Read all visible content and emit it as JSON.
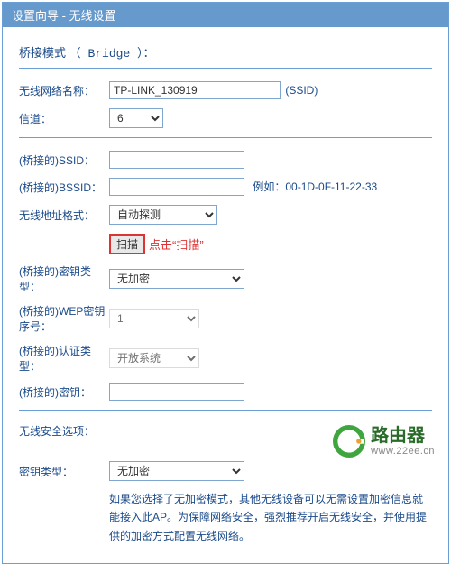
{
  "header": {
    "title": "设置向导 - 无线设置"
  },
  "mode": {
    "label": "桥接模式",
    "english": "（ Bridge ）："
  },
  "wlan": {
    "ssid_label": "无线网络名称：",
    "ssid_value": "TP-LINK_130919",
    "ssid_tag": "(SSID)",
    "channel_label": "信道：",
    "channel_value": "6"
  },
  "bridge": {
    "ssid_label": "(桥接的)SSID：",
    "ssid_value": "",
    "bssid_label": "(桥接的)BSSID：",
    "bssid_value": "",
    "bssid_example": "例如：00-1D-0F-11-22-33",
    "addr_label": "无线地址格式：",
    "addr_value": "自动探测",
    "scan_btn": "扫描",
    "scan_note": "点击“扫描”",
    "enc_label": "(桥接的)密钥类型：",
    "enc_value": "无加密",
    "wep_idx_label": "(桥接的)WEP密钥序号：",
    "wep_idx_value": "1",
    "auth_label": "(桥接的)认证类型：",
    "auth_value": "开放系统",
    "key_label": "(桥接的)密钥：",
    "key_value": ""
  },
  "security": {
    "options_label": "无线安全选项：",
    "enc_label": "密钥类型：",
    "enc_value": "无加密",
    "note": "如果您选择了无加密模式，其他无线设备可以无需设置加密信息就能接入此AP。为保障网络安全，强烈推荐开启无线安全，并使用提供的加密方式配置无线网络。"
  },
  "logo": {
    "name": "路由器",
    "url": "www.22ee.cn"
  }
}
